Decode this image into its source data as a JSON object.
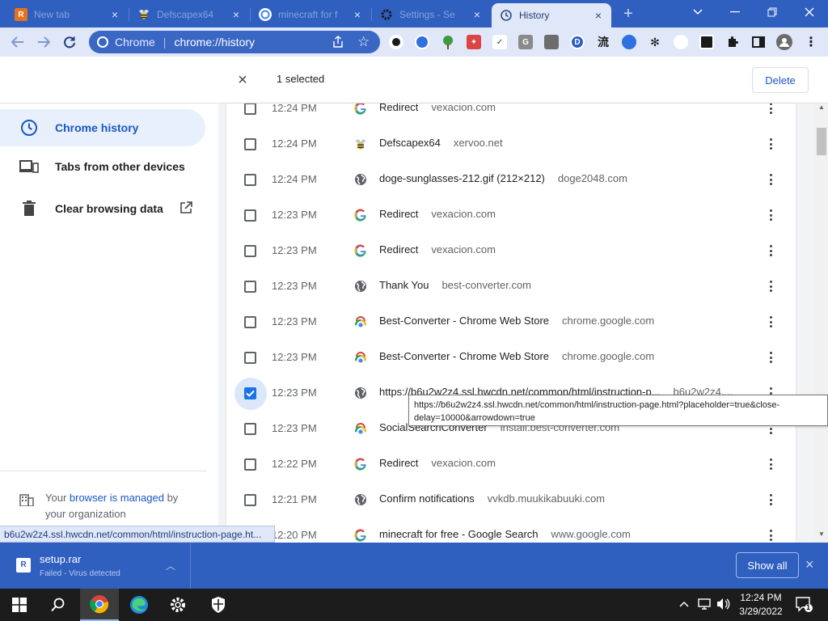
{
  "tabs": [
    {
      "title": "New tab",
      "favicon": "r-app-icon"
    },
    {
      "title": "Defscapex64",
      "favicon": "bee-icon"
    },
    {
      "title": "minecraft for f",
      "favicon": "google-icon"
    },
    {
      "title": "Settings - Se",
      "favicon": "gear-icon"
    },
    {
      "title": "History",
      "favicon": "history-icon",
      "active": true
    }
  ],
  "omnibox": {
    "origin": "Chrome",
    "url": "chrome://history"
  },
  "selection": {
    "count_label": "1 selected",
    "delete_label": "Delete"
  },
  "sidebar": {
    "items": [
      {
        "label": "Chrome history",
        "icon": "clock-icon",
        "active": true
      },
      {
        "label": "Tabs from other devices",
        "icon": "devices-icon"
      },
      {
        "label": "Clear browsing data",
        "icon": "trash-icon"
      }
    ],
    "managed_prefix": "Your ",
    "managed_link": "browser is managed",
    "managed_suffix": " by your organization"
  },
  "history": [
    {
      "time": "12:24 PM",
      "title": "Redirect",
      "domain": "vexacion.com",
      "favicon": "google"
    },
    {
      "time": "12:24 PM",
      "title": "Defscapex64",
      "domain": "xervoo.net",
      "favicon": "bee"
    },
    {
      "time": "12:24 PM",
      "title": "doge-sunglasses-212.gif (212×212)",
      "domain": "doge2048.com",
      "favicon": "globe"
    },
    {
      "time": "12:23 PM",
      "title": "Redirect",
      "domain": "vexacion.com",
      "favicon": "google"
    },
    {
      "time": "12:23 PM",
      "title": "Redirect",
      "domain": "vexacion.com",
      "favicon": "google"
    },
    {
      "time": "12:23 PM",
      "title": "Thank You",
      "domain": "best-converter.com",
      "favicon": "globe"
    },
    {
      "time": "12:23 PM",
      "title": "Best-Converter - Chrome Web Store",
      "domain": "chrome.google.com",
      "favicon": "webstore"
    },
    {
      "time": "12:23 PM",
      "title": "Best-Converter - Chrome Web Store",
      "domain": "chrome.google.com",
      "favicon": "webstore"
    },
    {
      "time": "12:23 PM",
      "title": "https://b6u2w2z4.ssl.hwcdn.net/common/html/instruction-p...",
      "domain": "b6u2w2z4....",
      "favicon": "globe",
      "checked": true
    },
    {
      "time": "12:23 PM",
      "title": "SocialSearchConverter",
      "domain": "install.best-converter.com",
      "favicon": "webstore"
    },
    {
      "time": "12:22 PM",
      "title": "Redirect",
      "domain": "vexacion.com",
      "favicon": "google"
    },
    {
      "time": "12:21 PM",
      "title": "Confirm notifications",
      "domain": "vvkdb.muukikabuuki.com",
      "favicon": "globe"
    },
    {
      "time": "12:20 PM",
      "title": "minecraft for free - Google Search",
      "domain": "www.google.com",
      "favicon": "google"
    }
  ],
  "tooltip": "https://b6u2w2z4.ssl.hwcdn.net/common/html/instruction-page.html?placeholder=true&close-delay=10000&arrowdown=true",
  "status_link": "b6u2w2z4.ssl.hwcdn.net/common/html/instruction-page.ht...",
  "download": {
    "filename": "setup.rar",
    "status": "Failed - Virus detected",
    "show_all": "Show all"
  },
  "taskbar": {
    "time": "12:24 PM",
    "date": "3/29/2022",
    "notif_count": "1"
  },
  "colors": {
    "chrome_frame": "#2f5fbf",
    "toolbar": "#dfe7f8",
    "accent": "#1a73e8",
    "link": "#1a56c4"
  }
}
